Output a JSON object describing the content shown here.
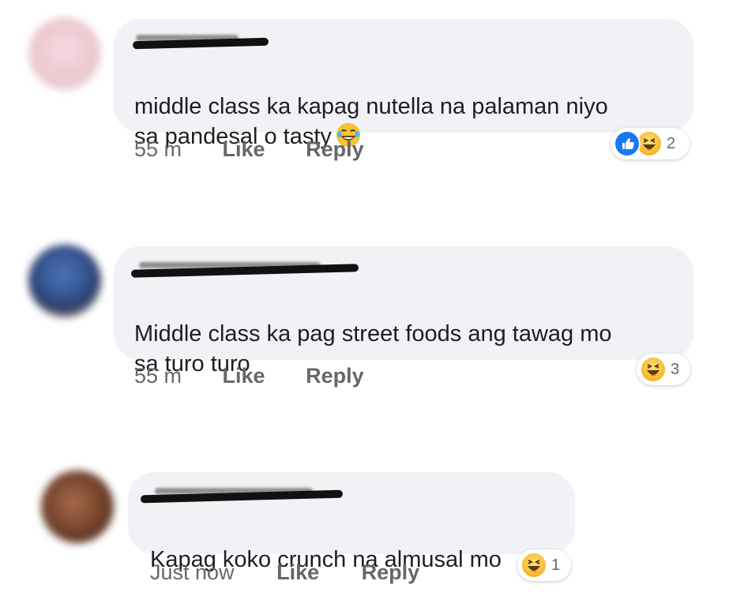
{
  "comments": [
    {
      "text": "middle class ka kapag nutella na palaman niyo\nsa pandesal o tasty",
      "inline_emoji": "tears-of-joy-emoji",
      "time": "55 m",
      "like_label": "Like",
      "reply_label": "Reply",
      "reactions": [
        "like-reaction-icon",
        "haha-reaction-icon"
      ],
      "reaction_count": "2"
    },
    {
      "text": "Middle class ka pag street foods ang tawag mo\nsa turo turo",
      "time": "55 m",
      "like_label": "Like",
      "reply_label": "Reply",
      "reactions": [
        "haha-reaction-icon"
      ],
      "reaction_count": "3"
    },
    {
      "text": "Kapag koko crunch na almusal mo",
      "time": "Just now",
      "like_label": "Like",
      "reply_label": "Reply",
      "reactions": [
        "haha-reaction-icon"
      ],
      "reaction_count": "1"
    }
  ],
  "colors": {
    "bubble": "#f0f2f5",
    "meta_text": "#65676b",
    "like_blue": "#1877f2",
    "haha_yellow": "#f7b928"
  }
}
